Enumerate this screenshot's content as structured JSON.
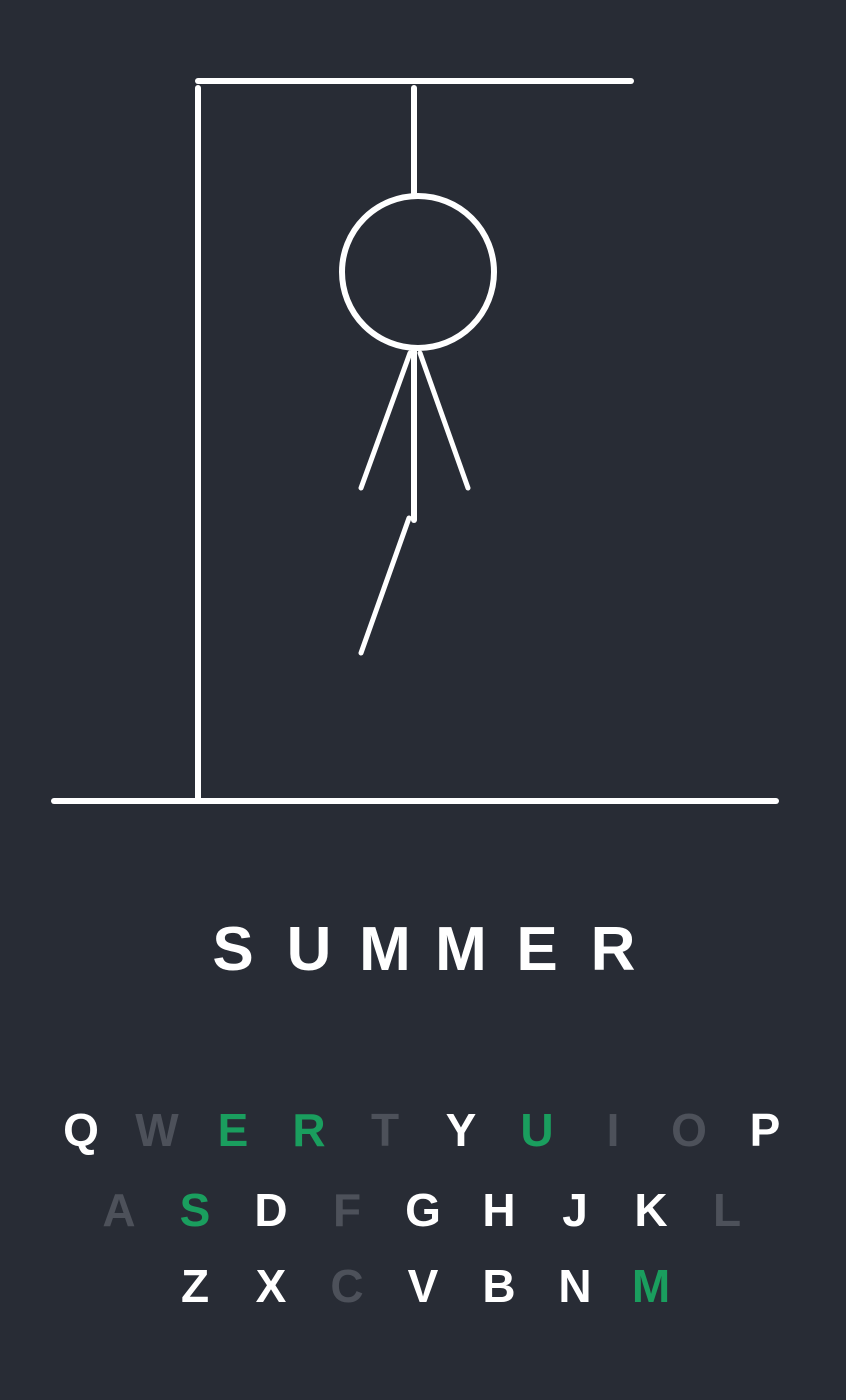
{
  "colors": {
    "background": "#282c35",
    "drawing": "#ffffff",
    "key_available": "#ffffff",
    "key_wrong": "#4d515a",
    "key_correct": "#1a9e5e"
  },
  "word": [
    "S",
    "U",
    "M",
    "M",
    "E",
    "R"
  ],
  "keyboard": {
    "row1": [
      {
        "letter": "Q",
        "state": "available"
      },
      {
        "letter": "W",
        "state": "wrong"
      },
      {
        "letter": "E",
        "state": "correct"
      },
      {
        "letter": "R",
        "state": "correct"
      },
      {
        "letter": "T",
        "state": "wrong"
      },
      {
        "letter": "Y",
        "state": "available"
      },
      {
        "letter": "U",
        "state": "correct"
      },
      {
        "letter": "I",
        "state": "wrong"
      },
      {
        "letter": "O",
        "state": "wrong"
      },
      {
        "letter": "P",
        "state": "available"
      }
    ],
    "row2": [
      {
        "letter": "A",
        "state": "wrong"
      },
      {
        "letter": "S",
        "state": "correct"
      },
      {
        "letter": "D",
        "state": "available"
      },
      {
        "letter": "F",
        "state": "wrong"
      },
      {
        "letter": "G",
        "state": "available"
      },
      {
        "letter": "H",
        "state": "available"
      },
      {
        "letter": "J",
        "state": "available"
      },
      {
        "letter": "K",
        "state": "available"
      },
      {
        "letter": "L",
        "state": "wrong"
      }
    ],
    "row3": [
      {
        "letter": "Z",
        "state": "available"
      },
      {
        "letter": "X",
        "state": "available"
      },
      {
        "letter": "C",
        "state": "wrong"
      },
      {
        "letter": "V",
        "state": "available"
      },
      {
        "letter": "B",
        "state": "available"
      },
      {
        "letter": "N",
        "state": "available"
      },
      {
        "letter": "M",
        "state": "correct"
      }
    ]
  },
  "hangman": {
    "parts_drawn": [
      "head",
      "body",
      "left-arm",
      "right-arm",
      "left-leg"
    ]
  }
}
